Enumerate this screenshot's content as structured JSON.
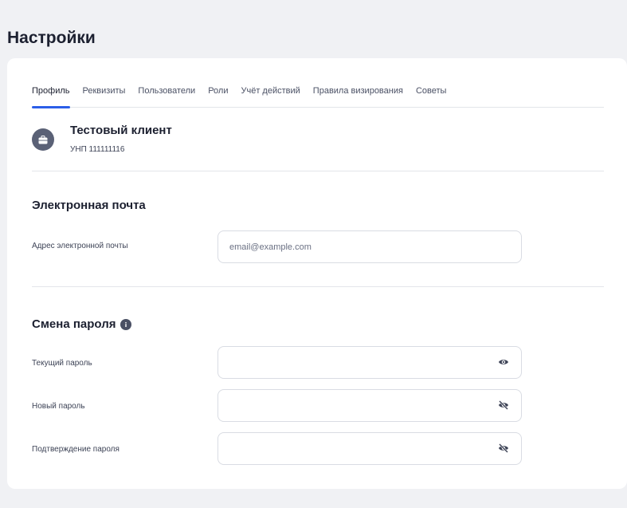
{
  "page": {
    "title": "Настройки"
  },
  "tabs": [
    {
      "label": "Профиль",
      "active": true
    },
    {
      "label": "Реквизиты"
    },
    {
      "label": "Пользователи"
    },
    {
      "label": "Роли"
    },
    {
      "label": "Учёт действий"
    },
    {
      "label": "Правила визирования"
    },
    {
      "label": "Советы"
    }
  ],
  "client": {
    "name": "Тестовый клиент",
    "unp": "УНП 111111116",
    "icon": "briefcase-icon"
  },
  "email_section": {
    "title": "Электронная почта",
    "field_label": "Адрес электронной почты",
    "placeholder": "email@example.com",
    "value": ""
  },
  "password_section": {
    "title": "Смена пароля",
    "info_icon": "info-icon",
    "current_label": "Текущий пароль",
    "new_label": "Новый пароль",
    "confirm_label": "Подтверждение пароля",
    "current_icon": "eye-icon",
    "new_icon": "eye-off-icon",
    "confirm_icon": "eye-off-icon"
  },
  "colors": {
    "accent": "#2b5ee8",
    "background": "#f0f1f4",
    "avatar": "#5a6176"
  }
}
